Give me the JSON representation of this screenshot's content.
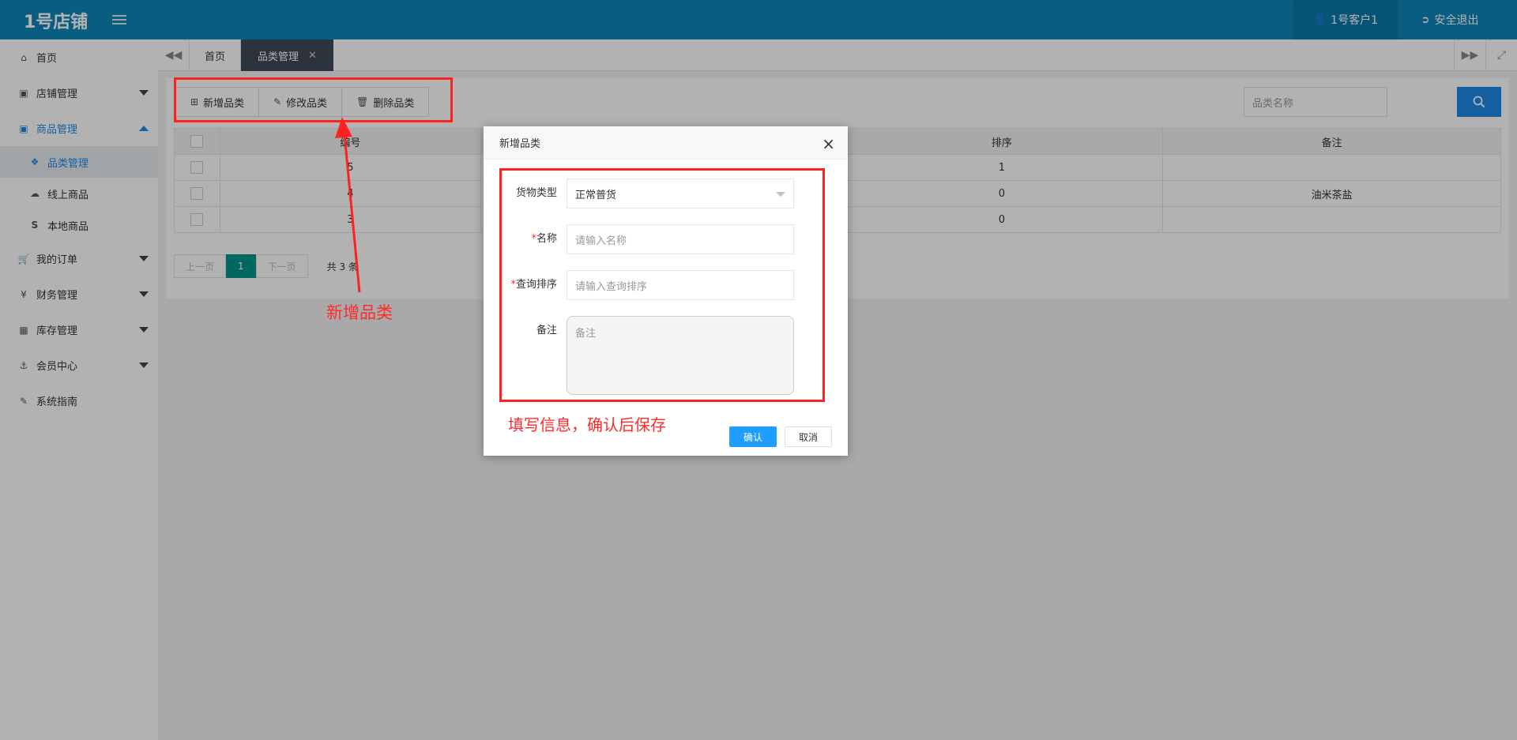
{
  "header": {
    "logo": "1号店铺",
    "user": "1号客户1",
    "logout": "安全退出"
  },
  "sidebar": {
    "items": [
      {
        "label": "首页",
        "icon": "home-icon"
      },
      {
        "label": "店铺管理",
        "icon": "shop-icon"
      },
      {
        "label": "商品管理",
        "icon": "bag-icon"
      },
      {
        "label": "品类管理",
        "icon": "tags-icon"
      },
      {
        "label": "线上商品",
        "icon": "cloud-icon"
      },
      {
        "label": "本地商品",
        "icon": "s-icon"
      },
      {
        "label": "我的订单",
        "icon": "cart-icon"
      },
      {
        "label": "财务管理",
        "icon": "yen-icon"
      },
      {
        "label": "库存管理",
        "icon": "table-icon"
      },
      {
        "label": "会员中心",
        "icon": "anchor-icon"
      },
      {
        "label": "系统指南",
        "icon": "doc-icon"
      }
    ]
  },
  "tabs": {
    "home": "首页",
    "current": "品类管理"
  },
  "toolbar": {
    "add": "新增品类",
    "edit": "修改品类",
    "delete": "删除品类"
  },
  "search": {
    "placeholder": "品类名称"
  },
  "table": {
    "headers": [
      "编号",
      "排序",
      "备注"
    ],
    "rows": [
      {
        "id": "5",
        "sort": "1",
        "note": ""
      },
      {
        "id": "4",
        "sort": "0",
        "note": "油米茶盐"
      },
      {
        "id": "3",
        "sort": "0",
        "note": ""
      }
    ]
  },
  "pager": {
    "prev": "上一页",
    "page": "1",
    "next": "下一页",
    "total": "共 3 条"
  },
  "annotations": {
    "add": "新增品类",
    "fill": "填写信息，确认后保存"
  },
  "dialog": {
    "title": "新增品类",
    "close": "×",
    "fields": {
      "type_label": "货物类型",
      "type_value": "正常普货",
      "name_label": "名称",
      "name_placeholder": "请输入名称",
      "sort_label": "查询排序",
      "sort_placeholder": "请输入查询排序",
      "note_label": "备注",
      "note_placeholder": "备注",
      "required_mark": "*"
    },
    "ok": "确认",
    "cancel": "取消"
  },
  "colors": {
    "header": "#0e86b8",
    "accent": "#1e88e5",
    "annotation": "#ff2020",
    "pager_current": "#009688"
  }
}
